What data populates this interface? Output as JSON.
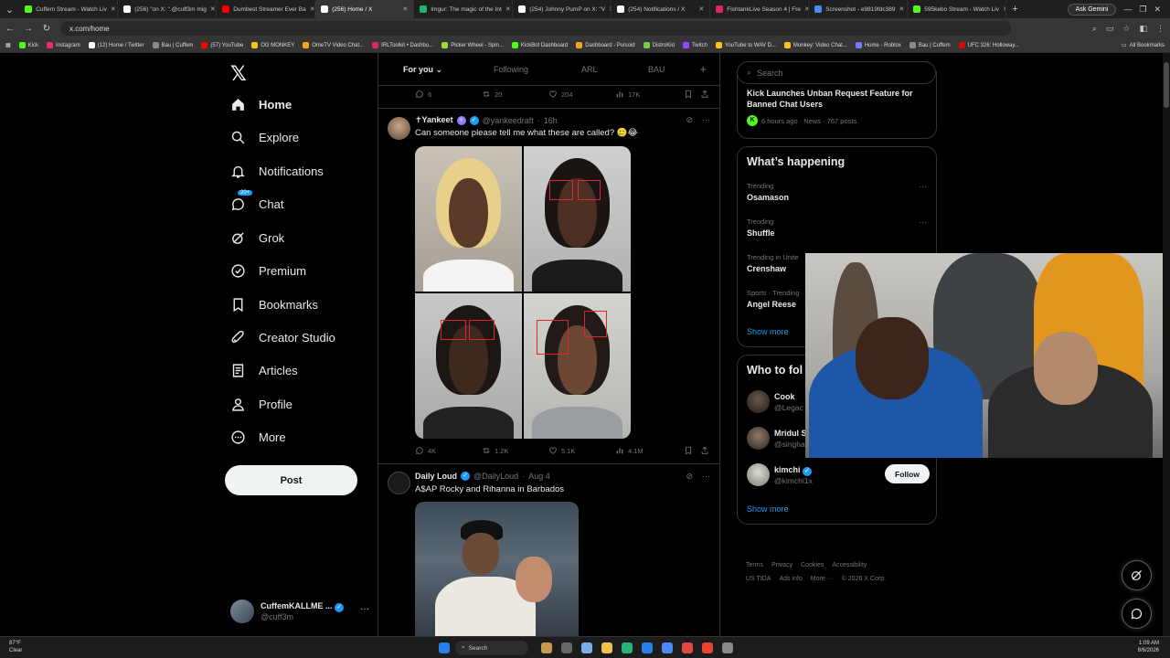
{
  "browser": {
    "tabs": [
      {
        "title": "Cuffem Stream - Watch Liv",
        "color": "#53fc18"
      },
      {
        "title": "(256) \"on X: \".@cuff3m mig",
        "color": "#ffffff"
      },
      {
        "title": "Dumbest Streamer Ever Ba",
        "color": "#ff0000"
      },
      {
        "title": "(256) Home / X",
        "color": "#ffffff",
        "active": true
      },
      {
        "title": "Imgur: The magic of the Int",
        "color": "#1bb76e"
      },
      {
        "title": "(254) Johnny PumP on X: \"V",
        "color": "#ffffff"
      },
      {
        "title": "(254) Notifications / X",
        "color": "#ffffff"
      },
      {
        "title": "FishtankLive Season 4 | Fre",
        "color": "#e0245e"
      },
      {
        "title": "Screenshot - e9819fdc389",
        "color": "#4c8bf5"
      },
      {
        "title": "595kebo Stream - Watch Liv",
        "color": "#53fc18"
      }
    ],
    "gemini_label": "Ask Gemini",
    "url": "x.com/home",
    "bookmarks": [
      {
        "label": "Kick",
        "color": "#53fc18"
      },
      {
        "label": "Instagram",
        "color": "#e1306c"
      },
      {
        "label": "(12) Home / Twitter",
        "color": "#ffffff"
      },
      {
        "label": "Bau | Cuffem",
        "color": "#888888"
      },
      {
        "label": "(57) YouTube",
        "color": "#ff0000"
      },
      {
        "label": "OG MONKEY",
        "color": "#f5c518"
      },
      {
        "label": "OmeTV Video Chat...",
        "color": "#f5a623"
      },
      {
        "label": "IRLToolkit • Dashbo...",
        "color": "#e0245e"
      },
      {
        "label": "Picker Wheel - Spin...",
        "color": "#a3d838"
      },
      {
        "label": "KickBot Dashboard",
        "color": "#53fc18"
      },
      {
        "label": "Dashboard - Pulsoid",
        "color": "#f5a623"
      },
      {
        "label": "DistroKid",
        "color": "#7ac943"
      },
      {
        "label": "Twitch",
        "color": "#9146ff"
      },
      {
        "label": "YouTube to WAV D...",
        "color": "#f5c518"
      },
      {
        "label": "Monkey: Video Chat...",
        "color": "#f5c518"
      },
      {
        "label": "Home - Roblox",
        "color": "#7a7aff"
      },
      {
        "label": "Bau | Cuffem",
        "color": "#888888"
      },
      {
        "label": "UFC 326: Holloway...",
        "color": "#d20a0a"
      }
    ],
    "all_bookmarks": "All Bookmarks"
  },
  "nav": {
    "items": [
      {
        "label": "Home",
        "icon": "home-icon"
      },
      {
        "label": "Explore",
        "icon": "search-icon"
      },
      {
        "label": "Notifications",
        "icon": "bell-icon"
      },
      {
        "label": "Chat",
        "icon": "chat-icon",
        "badge": "20+"
      },
      {
        "label": "Grok",
        "icon": "grok-icon"
      },
      {
        "label": "Premium",
        "icon": "premium-icon"
      },
      {
        "label": "Bookmarks",
        "icon": "bookmark-icon"
      },
      {
        "label": "Creator Studio",
        "icon": "rocket-icon"
      },
      {
        "label": "Articles",
        "icon": "article-icon"
      },
      {
        "label": "Profile",
        "icon": "profile-icon"
      },
      {
        "label": "More",
        "icon": "more-icon"
      }
    ],
    "post_label": "Post",
    "account": {
      "name": "CuffemKALLME ...",
      "handle": "@cuff3m"
    }
  },
  "feed": {
    "tabs": [
      "For you",
      "Following",
      "ARL",
      "BAU"
    ],
    "top_actions": {
      "replies": "6",
      "reposts": "20",
      "likes": "204",
      "views": "17K"
    },
    "tweets": [
      {
        "name": "✝Yankeet",
        "handle": "@yankeedraft",
        "time": "16h",
        "text": "Can someone please tell me what these are called? 🥲😂",
        "actions": {
          "replies": "4K",
          "reposts": "1.2K",
          "likes": "5.1K",
          "views": "4.1M"
        }
      },
      {
        "name": "Daily Loud",
        "handle": "@DailyLoud",
        "time": "Aug 4",
        "text": "A$AP Rocky and Rihanna in Barbados"
      }
    ]
  },
  "right": {
    "search_placeholder": "Search",
    "news": {
      "title": "Kick Launches Unban Request Feature for Banned Chat Users",
      "meta": "6 hours ago · News · 767 posts"
    },
    "happening": {
      "title": "What’s happening",
      "trends": [
        {
          "context": "Trending",
          "name": "Osamason"
        },
        {
          "context": "Trending",
          "name": "Shuffle"
        },
        {
          "context": "Trending in Unite",
          "name": "Crenshaw"
        },
        {
          "context": "Sports · Trending",
          "name": "Angel Reese"
        }
      ],
      "show_more": "Show more"
    },
    "who_to_follow": {
      "title": "Who to fol",
      "accounts": [
        {
          "name": "Cook",
          "handle": "@Legac"
        },
        {
          "name": "Mridul S",
          "handle": "@singha"
        },
        {
          "name": "kimchi",
          "handle": "@kimchi1x"
        }
      ],
      "follow_label": "Follow",
      "show_more": "Show more"
    },
    "footer": [
      "Terms",
      "Privacy",
      "Cookies",
      "Accessibility",
      "US TIDA",
      "Ads info",
      "More ···",
      "© 2026 X Corp."
    ]
  },
  "taskbar": {
    "weather_temp": "87°F",
    "weather_desc": "Clear",
    "search": "Search",
    "time": "1:09 AM",
    "date": "8/6/2026"
  }
}
